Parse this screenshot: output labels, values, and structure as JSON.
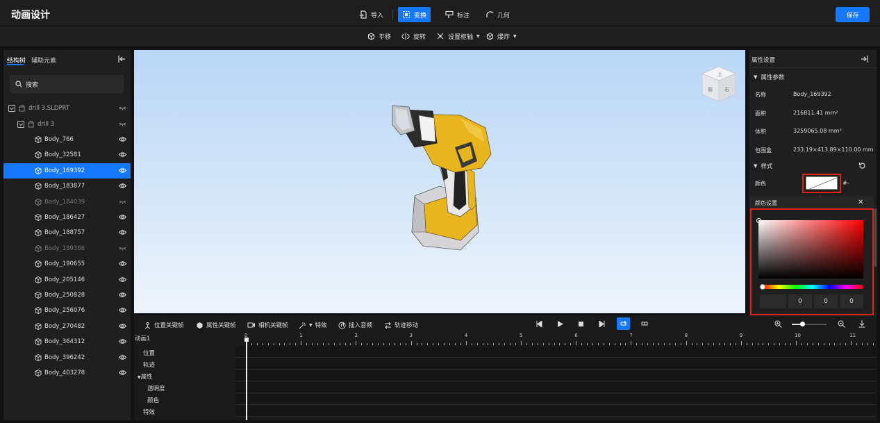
{
  "header": {
    "title": "动画设计",
    "tools": [
      {
        "label": "导入",
        "icon": "import-icon"
      },
      {
        "label": "变换",
        "icon": "transform-icon",
        "active": true
      },
      {
        "label": "标注",
        "icon": "annotation-icon"
      },
      {
        "label": "几何",
        "icon": "geometry-icon"
      }
    ],
    "save_label": "保存",
    "accent": "#1677ff"
  },
  "subtoolbar": {
    "items": [
      {
        "label": "平移",
        "icon": "move-icon"
      },
      {
        "label": "旋转",
        "icon": "rotate-icon"
      },
      {
        "label": "设置枢轴",
        "icon": "pivot-icon"
      },
      {
        "label": "爆炸",
        "icon": "explode-icon"
      }
    ]
  },
  "left_panel": {
    "tabs": [
      "结构树",
      "辅助元素"
    ],
    "search_placeholder": "搜索",
    "root": "drill 3.SLDPRT",
    "sub": "drill 3",
    "bodies": [
      {
        "label": "Body_766",
        "visible": true
      },
      {
        "label": "Body_32581",
        "visible": true
      },
      {
        "label": "Body_169392",
        "visible": true,
        "selected": true
      },
      {
        "label": "Body_183877",
        "visible": true
      },
      {
        "label": "Body_184039",
        "visible": false
      },
      {
        "label": "Body_186427",
        "visible": true
      },
      {
        "label": "Body_188757",
        "visible": true
      },
      {
        "label": "Body_189366",
        "visible": false
      },
      {
        "label": "Body_190655",
        "visible": true
      },
      {
        "label": "Body_205146",
        "visible": true
      },
      {
        "label": "Body_250828",
        "visible": true
      },
      {
        "label": "Body_256076",
        "visible": true
      },
      {
        "label": "Body_270482",
        "visible": true
      },
      {
        "label": "Body_364312",
        "visible": true
      },
      {
        "label": "Body_396242",
        "visible": true
      },
      {
        "label": "Body_403278",
        "visible": true
      }
    ]
  },
  "viewport": {
    "navcube_faces": [
      "上",
      "前",
      "右"
    ]
  },
  "right_panel": {
    "title": "属性设置",
    "section_params": "属性参数",
    "props": [
      {
        "label": "名称",
        "value": "Body_169392"
      },
      {
        "label": "面积",
        "value": "216811.41 mm²"
      },
      {
        "label": "体积",
        "value": "3259065.08 mm³"
      },
      {
        "label": "包围盒",
        "value": "233.19×413.89×110.00 mm"
      }
    ],
    "section_style": "样式",
    "color_label": "颜色",
    "color_hex": "#-",
    "color_settings_title": "颜色设置",
    "rgb": [
      "0",
      "0",
      "0"
    ]
  },
  "timeline": {
    "tools": [
      {
        "label": "位置关键帧",
        "icon": "position-keyframe-icon"
      },
      {
        "label": "属性关键帧",
        "icon": "property-keyframe-icon"
      },
      {
        "label": "相机关键帧",
        "icon": "camera-keyframe-icon"
      },
      {
        "label": "特效",
        "icon": "effects-icon"
      },
      {
        "label": "插入音频",
        "icon": "audio-icon"
      },
      {
        "label": "轨迹移动",
        "icon": "track-move-icon"
      }
    ],
    "animation_name": "动画1",
    "rows": [
      "位置",
      "轨迹",
      "属性",
      "透明度",
      "颜色",
      "特效"
    ],
    "ticks": [
      "0",
      "1",
      "2",
      "3",
      "4",
      "5",
      "6",
      "7",
      "8",
      "9",
      "10",
      "11"
    ],
    "zoom_level": 0.3
  }
}
